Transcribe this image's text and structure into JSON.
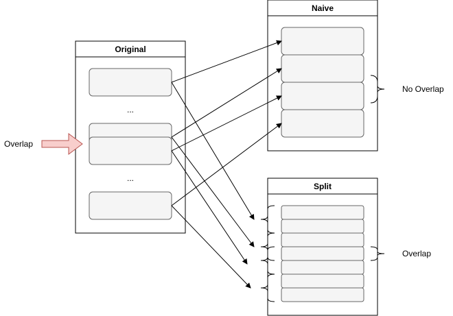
{
  "original": {
    "title": "Original",
    "ellipsis_top": "...",
    "ellipsis_bottom": "..."
  },
  "naive": {
    "title": "Naive",
    "annotation": "No Overlap"
  },
  "split": {
    "title": "Split",
    "annotation": "Overlap"
  },
  "overlap_label": "Overlap",
  "colors": {
    "arrow_fill": "#f8cecc",
    "arrow_stroke": "#b85450",
    "block_fill": "#f5f5f5",
    "block_stroke": "#666666"
  }
}
